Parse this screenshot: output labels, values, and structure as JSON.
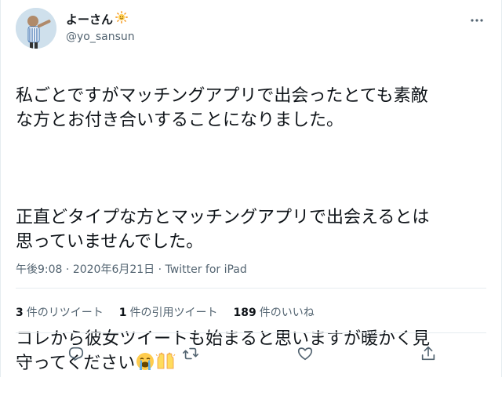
{
  "user": {
    "display_name": "よーさん",
    "name_emoji": "sun-emoji",
    "handle": "@yo_sansun",
    "avatar": "avatar-illustration"
  },
  "tweet": {
    "paragraph1": "私ごとですがマッチングアプリで出会ったとても素敵\nな方とお付き合いすることになりました。",
    "paragraph2": "正直どタイプな方とマッチングアプリで出会えるとは\n思っていませんでした。",
    "paragraph3": "コレから彼女ツイートも始まると思いますが暖かく見\n守ってください",
    "emoji_end": [
      "crying-face-emoji",
      "raised-hands-emoji"
    ]
  },
  "meta": {
    "time": "午後9:08",
    "separator1": " · ",
    "date": "2020年6月21日",
    "separator2": " · ",
    "source": "Twitter for iPad"
  },
  "stats": {
    "retweets_count": "3",
    "retweets_label": "件のリツイート",
    "quotes_count": "1",
    "quotes_label": "件の引用ツイート",
    "likes_count": "189",
    "likes_label": "件のいいね"
  },
  "icons": {
    "more": "more-icon",
    "reply": "reply-icon",
    "retweet": "retweet-icon",
    "like": "like-icon",
    "share": "share-icon"
  },
  "colors": {
    "text": "#0f1419",
    "secondary": "#536471",
    "border": "#e6ecf0"
  }
}
